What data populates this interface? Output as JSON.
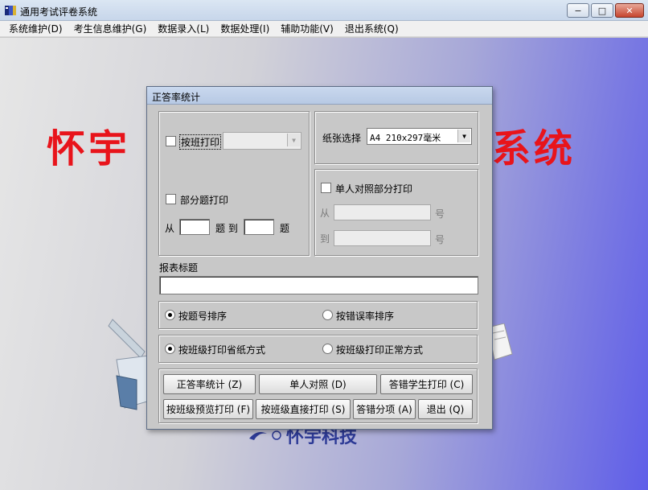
{
  "window": {
    "title": "通用考试评卷系统",
    "buttons": {
      "minimize": "−",
      "maximize": "□",
      "close": "✕"
    }
  },
  "menu": [
    "系统维护(D)",
    "考生信息维护(G)",
    "数据录入(L)",
    "数据处理(I)",
    "辅助功能(V)",
    "退出系统(Q)"
  ],
  "background": {
    "banner_left": "怀宇",
    "banner_right": "系统",
    "brand_text": "怀宇科技"
  },
  "dialog": {
    "title": "正答率统计",
    "print_by_class": {
      "label": "按班打印",
      "checked": false,
      "class_value": ""
    },
    "paper": {
      "label": "纸张选择",
      "value": "A4 210x297毫米"
    },
    "partial": {
      "label": "部分题打印",
      "checked": false,
      "from_label": "从",
      "mid_label": "题 到",
      "end_label": "题",
      "from_value": "",
      "to_value": ""
    },
    "single": {
      "label": "单人对照部分打印",
      "checked": false,
      "from_label": "从",
      "to_label": "到",
      "suffix": "号",
      "from_value": "",
      "to_value": ""
    },
    "report_title": {
      "label": "报表标题",
      "value": ""
    },
    "sort": {
      "option1": "按题号排序",
      "option2": "按错误率排序",
      "selected": "option1"
    },
    "mode": {
      "option1": "按班级打印省纸方式",
      "option2": "按班级打印正常方式",
      "selected": "option1"
    },
    "buttons": {
      "stats": "正答率统计 (Z)",
      "single_compare": "单人对照 (D)",
      "wrong_students": "答错学生打印 (C)",
      "class_preview": "按班级预览打印 (F)",
      "class_direct": "按班级直接打印 (S)",
      "wrong_items": "答错分项 (A)",
      "exit": "退出 (Q)"
    }
  },
  "colors": {
    "banner": "#e8141b",
    "brand": "#2d3a96",
    "dialog_bg": "#c8c8c8"
  }
}
